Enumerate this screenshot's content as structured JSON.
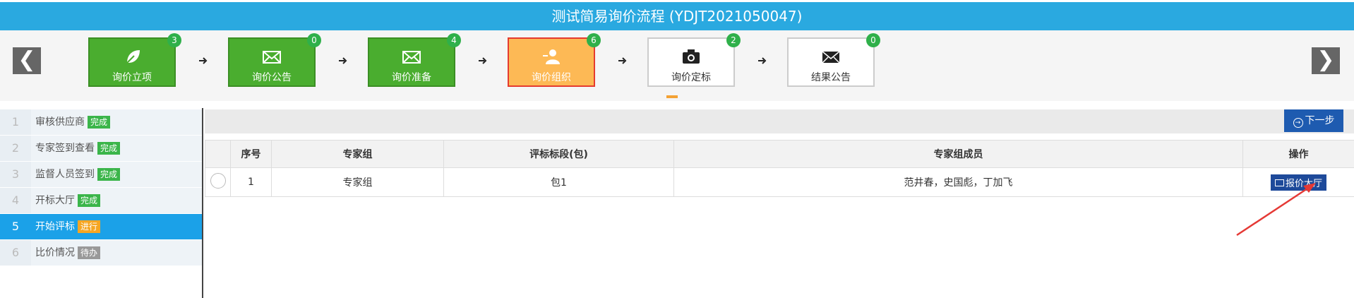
{
  "header": {
    "title": "测试简易询价流程 (YDJT2021050047)"
  },
  "nav": {
    "prev": "❮",
    "next": "❯"
  },
  "steps": [
    {
      "label": "询价立项",
      "badge": "3",
      "icon": "leaf-icon",
      "state": "done"
    },
    {
      "label": "询价公告",
      "badge": "0",
      "icon": "envelope-icon",
      "state": "done"
    },
    {
      "label": "询价准备",
      "badge": "4",
      "icon": "envelope-icon",
      "state": "done"
    },
    {
      "label": "询价组织",
      "badge": "6",
      "icon": "user-icon",
      "state": "active"
    },
    {
      "label": "询价定标",
      "badge": "2",
      "icon": "camera-icon",
      "state": "pending"
    },
    {
      "label": "结果公告",
      "badge": "0",
      "icon": "envelope-icon",
      "state": "pending"
    }
  ],
  "sidebar": {
    "items": [
      {
        "num": "1",
        "label": "审核供应商",
        "status": "完成"
      },
      {
        "num": "2",
        "label": "专家签到查看",
        "status": "完成"
      },
      {
        "num": "3",
        "label": "监督人员签到",
        "status": "完成"
      },
      {
        "num": "4",
        "label": "开标大厅",
        "status": "完成"
      },
      {
        "num": "5",
        "label": "开始评标",
        "status": "进行"
      },
      {
        "num": "6",
        "label": "比价情况",
        "status": "待办"
      }
    ]
  },
  "toolbar": {
    "next_step": "下一步"
  },
  "table": {
    "headers": [
      "",
      "序号",
      "专家组",
      "评标标段(包)",
      "专家组成员",
      "操作"
    ],
    "rows": [
      {
        "index": "1",
        "group": "专家组",
        "lot": "包1",
        "members": "范井春，史国彪，丁加飞",
        "action": "报价大厅"
      }
    ]
  },
  "colors": {
    "title_bar": "#2aa9e0",
    "done": "#4aad2f",
    "active": "#fdb955",
    "current_sidebar": "#1ba1e8",
    "button": "#1e5bb0"
  }
}
